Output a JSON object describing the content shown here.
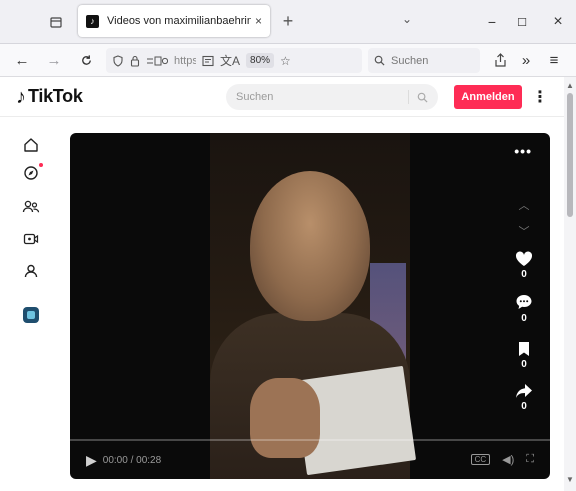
{
  "browser": {
    "tab": {
      "title": "Videos von maximilianbaehring",
      "close_glyph": "×"
    },
    "newtab_glyph": "+",
    "tabs_dropdown_glyph": "⌄",
    "window": {
      "minimize_glyph": "−",
      "maximize_glyph": "☐",
      "close_glyph": "×"
    },
    "urlbar": {
      "url_text": "https://",
      "zoom_level": "80%"
    },
    "searchbar": {
      "placeholder": "Suchen"
    },
    "icons": [
      "tab-list-icon",
      "back-icon",
      "forward-icon",
      "reload-icon",
      "shield-icon",
      "lock-icon",
      "permissions-icon",
      "reader-icon",
      "translate-icon",
      "star-icon",
      "share-icon",
      "overflow-icon",
      "menu-icon"
    ]
  },
  "tiktok": {
    "logo_text": "TikTok",
    "search_placeholder": "Suchen",
    "login_label": "Anmelden",
    "more_glyph": "⋮",
    "sidebar": [
      "home-icon",
      "explore-icon",
      "following-icon",
      "live-icon",
      "profile-icon",
      "app-icon"
    ]
  },
  "player": {
    "time": "00:00 / 00:28",
    "cc_label": "CC",
    "more_glyph": "•••",
    "actions": {
      "likes": "0",
      "comments": "0",
      "saves": "0",
      "shares": "0"
    },
    "progress_fraction": 0
  },
  "colors": {
    "accent": "#fe2c55",
    "tab_strip": "#f0f0f4",
    "player_bg": "#0a0a0a"
  }
}
